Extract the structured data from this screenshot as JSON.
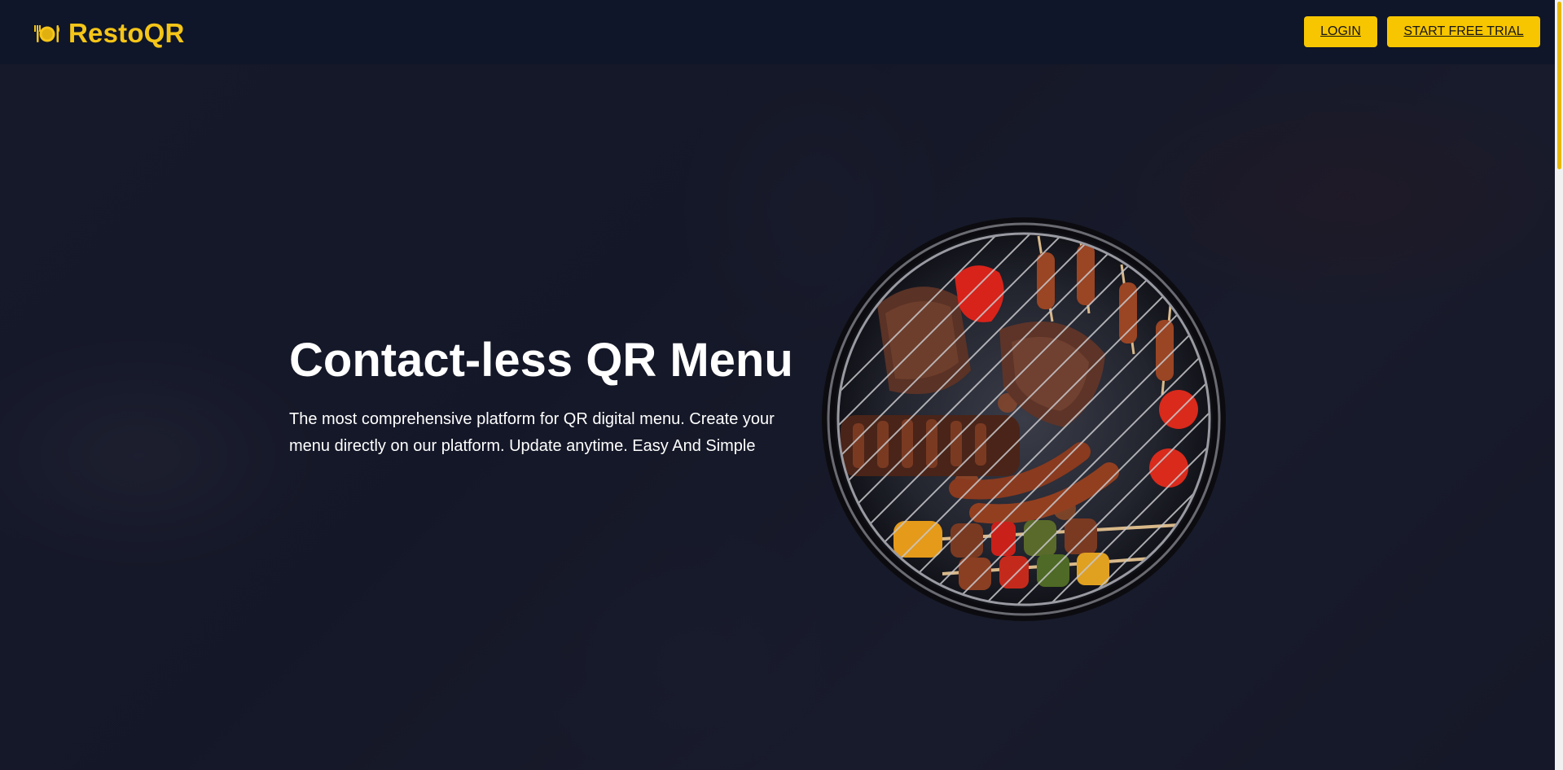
{
  "brand": {
    "name": "RestoQR",
    "icon": "plate-cutlery-icon",
    "color": "#f5c518"
  },
  "nav": {
    "login_label": "LOGIN",
    "trial_label": "START FREE TRIAL",
    "button_color": "#f7c600"
  },
  "hero": {
    "headline": "Contact-less QR Menu",
    "subtext": "The most comprehensive platform for QR digital menu. Create your menu directly on our platform. Update anytime. Easy And Simple",
    "image": "barbecue-grill-image"
  },
  "colors": {
    "topbar": "#0f1629",
    "accent": "#f5c518",
    "text": "#ffffff"
  }
}
